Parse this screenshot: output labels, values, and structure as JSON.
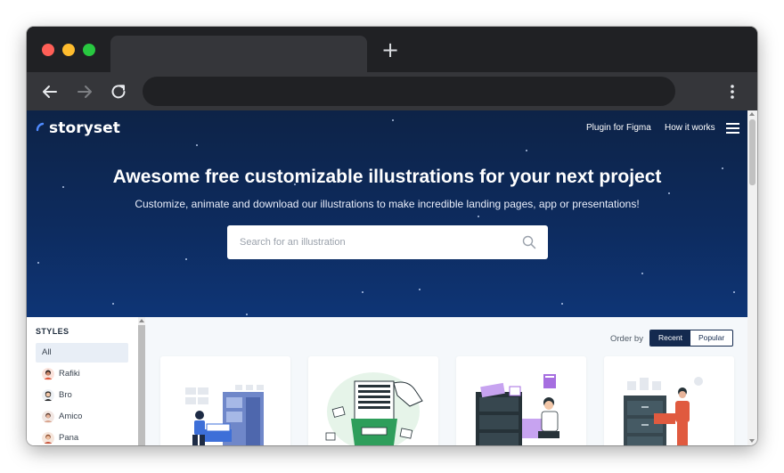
{
  "browser": {
    "tab_title": "",
    "new_tab_icon": "plus-icon",
    "address": "",
    "nav_icons": [
      "back-arrow-icon",
      "forward-arrow-icon",
      "reload-icon"
    ],
    "menu_icon": "vertical-dots-icon"
  },
  "site": {
    "logo": "storyset",
    "nav": {
      "plugin": "Plugin for Figma",
      "how": "How it works"
    },
    "hero": {
      "title": "Awesome free customizable illustrations for your next project",
      "subtitle": "Customize, animate and download our illustrations to make incredible landing pages, app or presentations!"
    },
    "search": {
      "placeholder": "Search for an illustration"
    },
    "sidebar": {
      "title": "STYLES",
      "items": [
        {
          "label": "All",
          "active": true
        },
        {
          "label": "Rafiki",
          "active": false
        },
        {
          "label": "Bro",
          "active": false
        },
        {
          "label": "Amico",
          "active": false
        },
        {
          "label": "Pana",
          "active": false
        }
      ]
    },
    "order": {
      "label": "Order by",
      "options": [
        {
          "label": "Recent",
          "active": true
        },
        {
          "label": "Popular",
          "active": false
        }
      ]
    },
    "colors": {
      "hero_top": "#0d2347",
      "hero_bottom": "#0e3576",
      "accent_blue": "#4f8bff",
      "order_active": "#142a4f"
    }
  }
}
